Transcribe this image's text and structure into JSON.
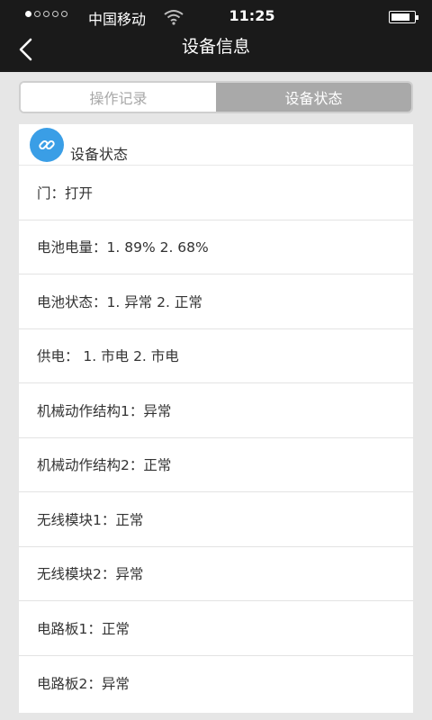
{
  "status_bar": {
    "carrier": "中国移动",
    "time": "11:25"
  },
  "nav": {
    "title": "设备信息",
    "back_icon": "chevron-left-icon"
  },
  "tabs": [
    {
      "label": "操作记录",
      "active": false
    },
    {
      "label": "设备状态",
      "active": true
    }
  ],
  "section": {
    "icon": "link-icon",
    "title": "设备状态"
  },
  "status_rows": [
    {
      "text": "门：打开"
    },
    {
      "text": "电池电量：1. 89% 2. 68%"
    },
    {
      "text": "电池状态：1. 异常 2. 正常"
    },
    {
      "text": "供电： 1. 市电 2. 市电"
    },
    {
      "text": "机械动作结构1：异常"
    },
    {
      "text": "机械动作结构2：正常"
    },
    {
      "text": "无线模块1：正常"
    },
    {
      "text": "无线模块2：异常"
    },
    {
      "text": "电路板1：正常"
    },
    {
      "text": "电路板2：异常"
    }
  ],
  "colors": {
    "topbar": "#1a1a1a",
    "accent_blue": "#3a9ee6",
    "tab_active": "#a9a9a9",
    "background": "#e6e6e6"
  }
}
